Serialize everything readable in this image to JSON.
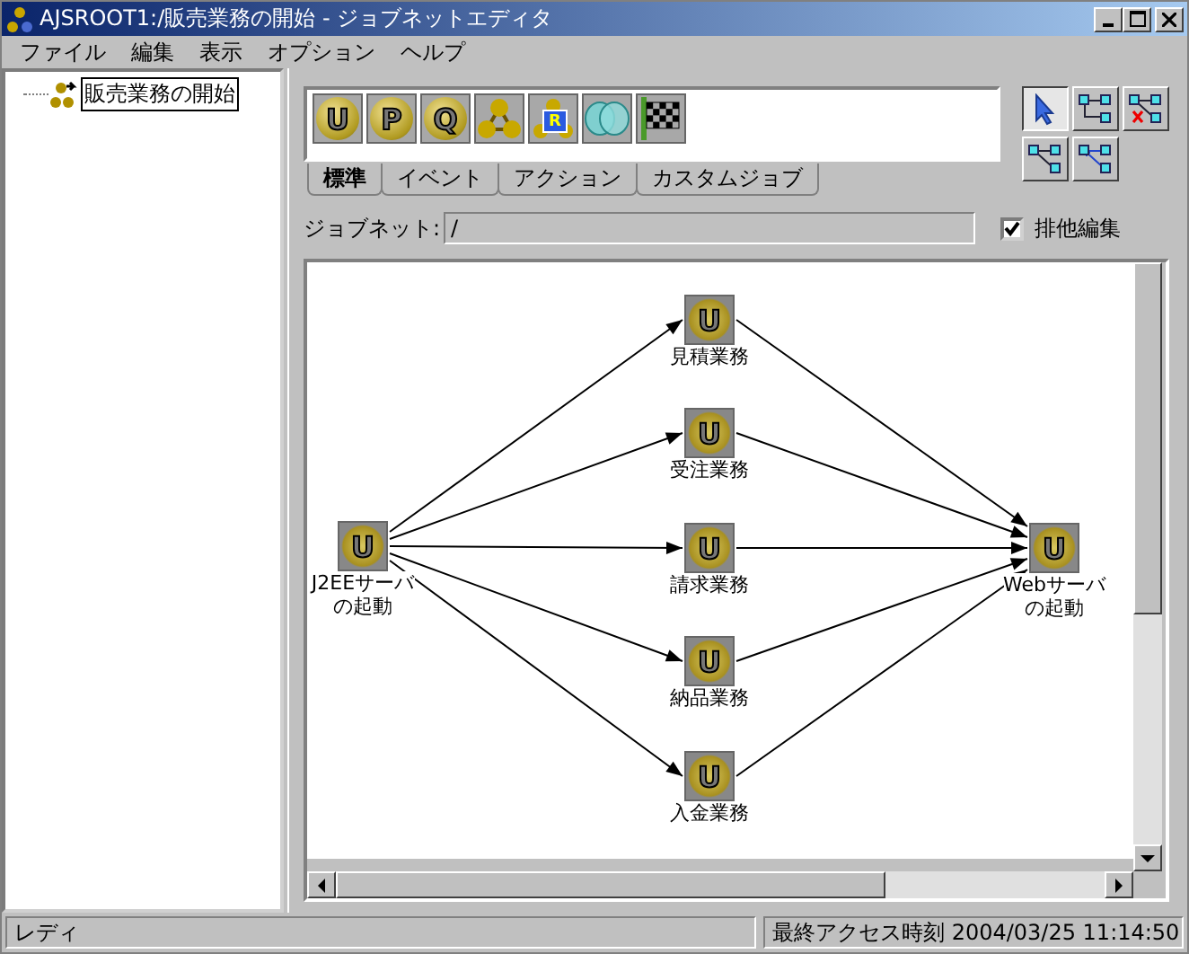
{
  "window": {
    "title": "AJSROOT1:/販売業務の開始 - ジョブネットエディタ"
  },
  "menu": [
    "ファイル",
    "編集",
    "表示",
    "オプション",
    "ヘルプ"
  ],
  "tree": {
    "items": [
      {
        "label": "販売業務の開始",
        "selected": true
      }
    ]
  },
  "palette": [
    {
      "kind": "letter",
      "text": "U"
    },
    {
      "kind": "letter",
      "text": "P"
    },
    {
      "kind": "letter",
      "text": "Q"
    },
    {
      "kind": "balls"
    },
    {
      "kind": "balls-badge",
      "text": "R"
    },
    {
      "kind": "rings"
    },
    {
      "kind": "flag"
    }
  ],
  "tabs": [
    {
      "label": "標準",
      "selected": true
    },
    {
      "label": "イベント",
      "selected": false
    },
    {
      "label": "アクション",
      "selected": false
    },
    {
      "label": "カスタムジョブ",
      "selected": false
    }
  ],
  "tools": [
    {
      "kind": "pointer",
      "selected": true
    },
    {
      "kind": "connect",
      "selected": false
    },
    {
      "kind": "disconnect",
      "selected": false
    },
    {
      "kind": "link-a",
      "selected": false
    },
    {
      "kind": "link-b",
      "selected": false
    }
  ],
  "jobnet_field": {
    "label": "ジョブネット:",
    "value": "/"
  },
  "exclusive_edit": {
    "label": "排他編集",
    "checked": true
  },
  "jobnet": {
    "start": {
      "icon": "U",
      "lines": [
        "J2EEサーバ",
        "の起動"
      ]
    },
    "middle": [
      {
        "icon": "U",
        "lines": [
          "見積業務"
        ]
      },
      {
        "icon": "U",
        "lines": [
          "受注業務"
        ]
      },
      {
        "icon": "U",
        "lines": [
          "請求業務"
        ]
      },
      {
        "icon": "U",
        "lines": [
          "納品業務"
        ]
      },
      {
        "icon": "U",
        "lines": [
          "入金業務"
        ]
      }
    ],
    "end": {
      "icon": "U",
      "lines": [
        "Webサーバ",
        "の起動"
      ]
    }
  },
  "status_bar": {
    "message": "レディ",
    "access_time": "最終アクセス時刻 2004/03/25 11:14:50"
  }
}
